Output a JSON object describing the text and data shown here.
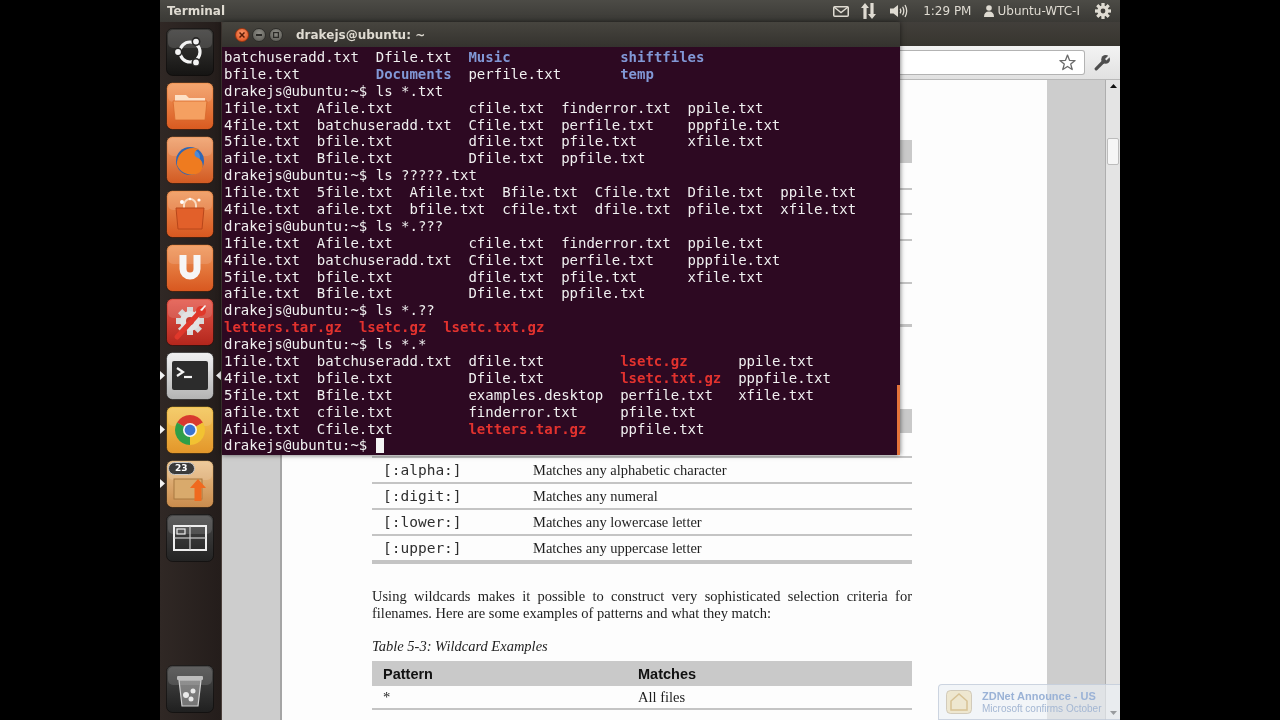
{
  "top_panel": {
    "app_title": "Terminal",
    "clock": "1:29 PM",
    "user": "Ubuntu-WTC-I"
  },
  "launcher": {
    "items": [
      {
        "kind": "dash",
        "running": false,
        "focused": false
      },
      {
        "kind": "files",
        "running": false,
        "focused": false
      },
      {
        "kind": "firefox",
        "running": false,
        "focused": false
      },
      {
        "kind": "software_center",
        "running": false,
        "focused": false
      },
      {
        "kind": "ubuntu_one",
        "running": false,
        "focused": false
      },
      {
        "kind": "settings",
        "running": false,
        "focused": false
      },
      {
        "kind": "terminal",
        "running": true,
        "focused": true
      },
      {
        "kind": "chrome",
        "running": true,
        "focused": false
      },
      {
        "kind": "update_manager",
        "running": true,
        "focused": false,
        "badge": "23"
      },
      {
        "kind": "workspaces",
        "running": false,
        "focused": false
      }
    ],
    "bottom_items": [
      {
        "kind": "trash",
        "running": false,
        "focused": false
      }
    ]
  },
  "terminal": {
    "title": "drakejs@ubuntu: ~",
    "lines": [
      {
        "kind": "folder_output",
        "text": "batchuseradd.txt  Dfile.txt  **Music**             **shiftfiles**"
      },
      {
        "kind": "folder_output",
        "text": "bfile.txt         **Documents**  perfile.txt       **temp**"
      },
      {
        "kind": "prompt",
        "prompt": "drakejs@ubuntu:~$",
        "command": "ls *.txt",
        "cursor": false
      },
      {
        "kind": "output",
        "text": "1file.txt  Afile.txt         cfile.txt  finderror.txt  ppile.txt"
      },
      {
        "kind": "output",
        "text": "4file.txt  batchuseradd.txt  Cfile.txt  perfile.txt    pppfile.txt"
      },
      {
        "kind": "output",
        "text": "5file.txt  bfile.txt         dfile.txt  pfile.txt      xfile.txt"
      },
      {
        "kind": "output",
        "text": "afile.txt  Bfile.txt         Dfile.txt  ppfile.txt"
      },
      {
        "kind": "prompt",
        "prompt": "drakejs@ubuntu:~$",
        "command": "ls ?????.txt",
        "cursor": false
      },
      {
        "kind": "output",
        "text": "1file.txt  5file.txt  Afile.txt  Bfile.txt  Cfile.txt  Dfile.txt  ppile.txt"
      },
      {
        "kind": "output",
        "text": "4file.txt  afile.txt  bfile.txt  cfile.txt  dfile.txt  pfile.txt  xfile.txt"
      },
      {
        "kind": "prompt",
        "prompt": "drakejs@ubuntu:~$",
        "command": "ls *.???",
        "cursor": false
      },
      {
        "kind": "output",
        "text": "1file.txt  Afile.txt         cfile.txt  finderror.txt  ppile.txt"
      },
      {
        "kind": "output",
        "text": "4file.txt  batchuseradd.txt  Cfile.txt  perfile.txt    pppfile.txt"
      },
      {
        "kind": "output",
        "text": "5file.txt  bfile.txt         dfile.txt  pfile.txt      xfile.txt"
      },
      {
        "kind": "output",
        "text": "afile.txt  Bfile.txt         Dfile.txt  ppfile.txt"
      },
      {
        "kind": "prompt",
        "prompt": "drakejs@ubuntu:~$",
        "command": "ls *.??",
        "cursor": false
      },
      {
        "kind": "archive_output",
        "text": "**letters.tar.gz**  **lsetc.gz**  **lsetc.txt.gz**"
      },
      {
        "kind": "prompt",
        "prompt": "drakejs@ubuntu:~$",
        "command": "ls *.*",
        "cursor": false
      },
      {
        "kind": "archive_output",
        "text": "1file.txt  batchuseradd.txt  dfile.txt         **lsetc.gz**      ppile.txt"
      },
      {
        "kind": "archive_output",
        "text": "4file.txt  bfile.txt         Dfile.txt         **lsetc.txt.gz**  pppfile.txt"
      },
      {
        "kind": "output",
        "text": "5file.txt  Bfile.txt         examples.desktop  perfile.txt   xfile.txt"
      },
      {
        "kind": "output",
        "text": "afile.txt  cfile.txt         finderror.txt     pfile.txt"
      },
      {
        "kind": "archive_output",
        "text": "Afile.txt  Cfile.txt         **letters.tar.gz**    ppfile.txt"
      },
      {
        "kind": "prompt",
        "prompt": "drakejs@ubuntu:~$",
        "cursor": true
      }
    ]
  },
  "browser": {
    "document": {
      "class_table": {
        "rows": [
          {
            "pattern": "[:alpha:]",
            "meaning": "Matches any alphabetic character"
          },
          {
            "pattern": "[:digit:]",
            "meaning": "Matches any numeral"
          },
          {
            "pattern": "[:lower:]",
            "meaning": "Matches any lowercase letter"
          },
          {
            "pattern": "[:upper:]",
            "meaning": "Matches any uppercase letter"
          }
        ]
      },
      "paragraph": "Using wildcards makes it possible to construct very sophisticated selection criteria for filenames. Here are some examples of patterns and what they match:",
      "caption": "Table 5-3: Wildcard Examples",
      "examples_table": {
        "columns": [
          "Pattern",
          "Matches"
        ],
        "rows": [
          {
            "pattern": "*",
            "meaning": "All files"
          }
        ]
      }
    }
  },
  "notification": {
    "title": "ZDNet Announce - US",
    "body": "Microsoft confirms October"
  }
}
